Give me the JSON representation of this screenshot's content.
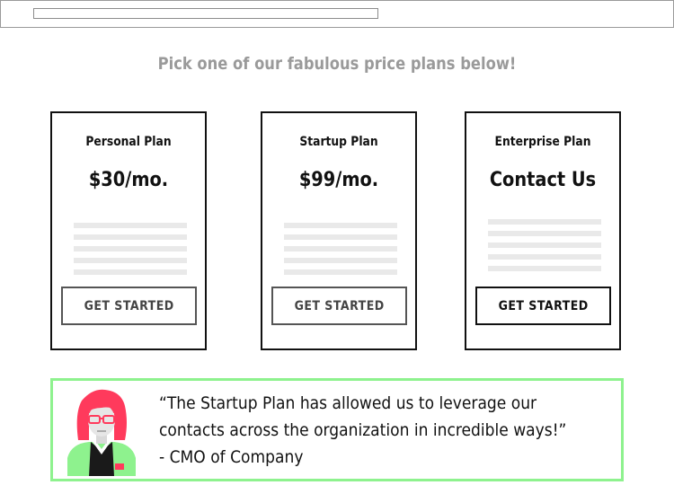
{
  "browser": {
    "url": ""
  },
  "headline": "Pick one of our fabulous price plans below!",
  "plans": [
    {
      "name": "Personal Plan",
      "price": "$30/mo.",
      "cta": "GET STARTED"
    },
    {
      "name": "Startup Plan",
      "price": "$99/mo.",
      "cta": "GET STARTED"
    },
    {
      "name": "Enterprise Plan",
      "price": "Contact Us",
      "cta": "GET STARTED"
    }
  ],
  "testimonial": {
    "quote_line1": "“The Startup Plan has allowed us to leverage our",
    "quote_line2": "contacts across the organization in incredible ways!”",
    "attribution": "- CMO of Company"
  },
  "colors": {
    "accent_border": "#8ef28e",
    "avatar_hair": "#ff3a5c",
    "avatar_shirt": "#8ef28e"
  }
}
